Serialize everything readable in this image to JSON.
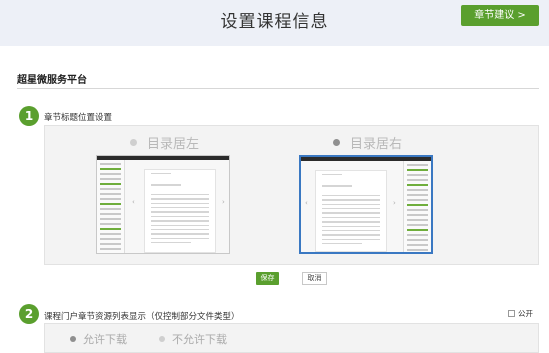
{
  "header": {
    "title": "设置课程信息",
    "chapter_button": "章节建议 >"
  },
  "platform_title": "超星微服务平台",
  "section1": {
    "step": "1",
    "label": "章节标题位置设置",
    "options": [
      {
        "label": "目录居左",
        "selected": false
      },
      {
        "label": "目录居右",
        "selected": true
      }
    ]
  },
  "actions": {
    "save": "保存",
    "cancel": "取消"
  },
  "section2": {
    "step": "2",
    "label": "课程门户章节资源列表显示（仅控制部分文件类型）",
    "public_label": "公开",
    "options": [
      {
        "label": "允许下载",
        "selected": true
      },
      {
        "label": "不允许下载",
        "selected": false
      }
    ]
  },
  "colors": {
    "accent": "#5a9f2e",
    "header_bg": "#edf0f7",
    "selection": "#3a78c2"
  }
}
